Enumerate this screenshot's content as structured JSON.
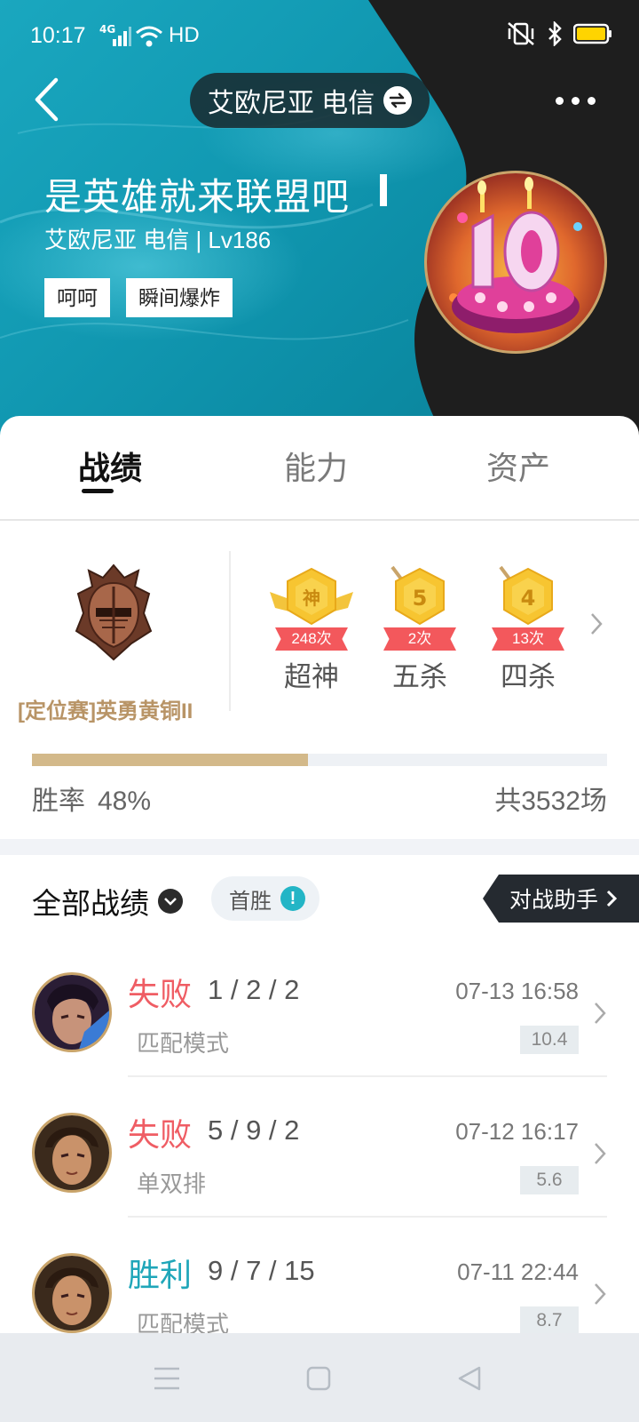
{
  "status_bar": {
    "time": "10:17",
    "network": "4G",
    "hd": "HD"
  },
  "header": {
    "server": "艾欧尼亚 电信",
    "player_name": "是英雄就来联盟吧",
    "subtitle": "艾欧尼亚 电信 | Lv186",
    "tags": [
      "呵呵",
      "瞬间爆炸"
    ],
    "colors": {
      "teal": "#1aa7bf",
      "dark": "#1e1e1e"
    }
  },
  "tabs": [
    {
      "label": "战绩",
      "active": true
    },
    {
      "label": "能力",
      "active": false
    },
    {
      "label": "资产",
      "active": false
    }
  ],
  "rank": {
    "label": "[定位赛]英勇黄铜II"
  },
  "achievements": [
    {
      "badge": "神",
      "count": "248次",
      "label": "超神"
    },
    {
      "badge": "5",
      "count": "2次",
      "label": "五杀"
    },
    {
      "badge": "4",
      "count": "13次",
      "label": "四杀"
    }
  ],
  "stats": {
    "winrate_label": "胜率",
    "winrate_value": "48%",
    "winrate_fraction": 0.48,
    "total_games": "共3532场"
  },
  "records": {
    "filter_label": "全部战绩",
    "first_win_label": "首胜",
    "info_glyph": "!",
    "assistant_label": "对战助手",
    "matches": [
      {
        "result": "失败",
        "outcome": "lose",
        "kda": "1 / 2 / 2",
        "mode": "匹配模式",
        "time": "07-13 16:58",
        "score": "10.4"
      },
      {
        "result": "失败",
        "outcome": "lose",
        "kda": "5 / 9 / 2",
        "mode": "单双排",
        "time": "07-12 16:17",
        "score": "5.6"
      },
      {
        "result": "胜利",
        "outcome": "win",
        "kda": "9 / 7 / 15",
        "mode": "匹配模式",
        "time": "07-11 22:44",
        "score": "8.7"
      }
    ]
  },
  "icons": {
    "back": "back-arrow-icon",
    "swap": "swap-icon",
    "more": "more-icon",
    "chevron": "chevron-right-icon"
  }
}
